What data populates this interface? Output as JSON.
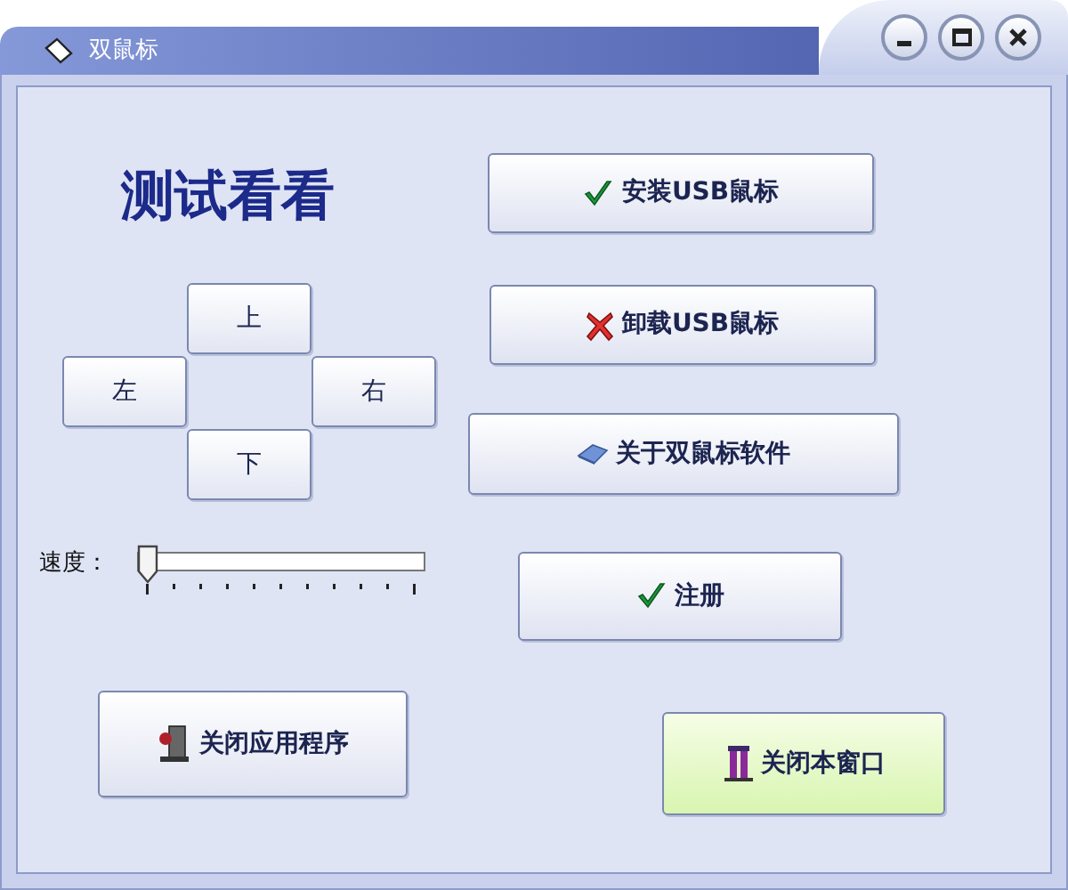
{
  "window": {
    "title": "双鼠标"
  },
  "heading": "测试看看",
  "direction_buttons": [
    {
      "label": "上",
      "kind": "up"
    },
    {
      "label": "左",
      "kind": "left"
    },
    {
      "label": "右",
      "kind": "right"
    },
    {
      "label": "下",
      "kind": "down"
    }
  ],
  "speed": {
    "label": "速度：",
    "level": 0
  },
  "close_app_button": {
    "label": "关闭应用程序"
  },
  "actions": [
    {
      "label": "安装USB鼠标",
      "kind": "check",
      "highlighted": false
    },
    {
      "label": "卸载USB鼠标",
      "kind": "cross",
      "highlighted": false
    },
    {
      "label": "关于双鼠标软件",
      "kind": "disk",
      "highlighted": false
    },
    {
      "label": "注册",
      "kind": "check",
      "highlighted": false
    },
    {
      "label": "关闭本窗口",
      "kind": "person",
      "highlighted": true
    }
  ]
}
